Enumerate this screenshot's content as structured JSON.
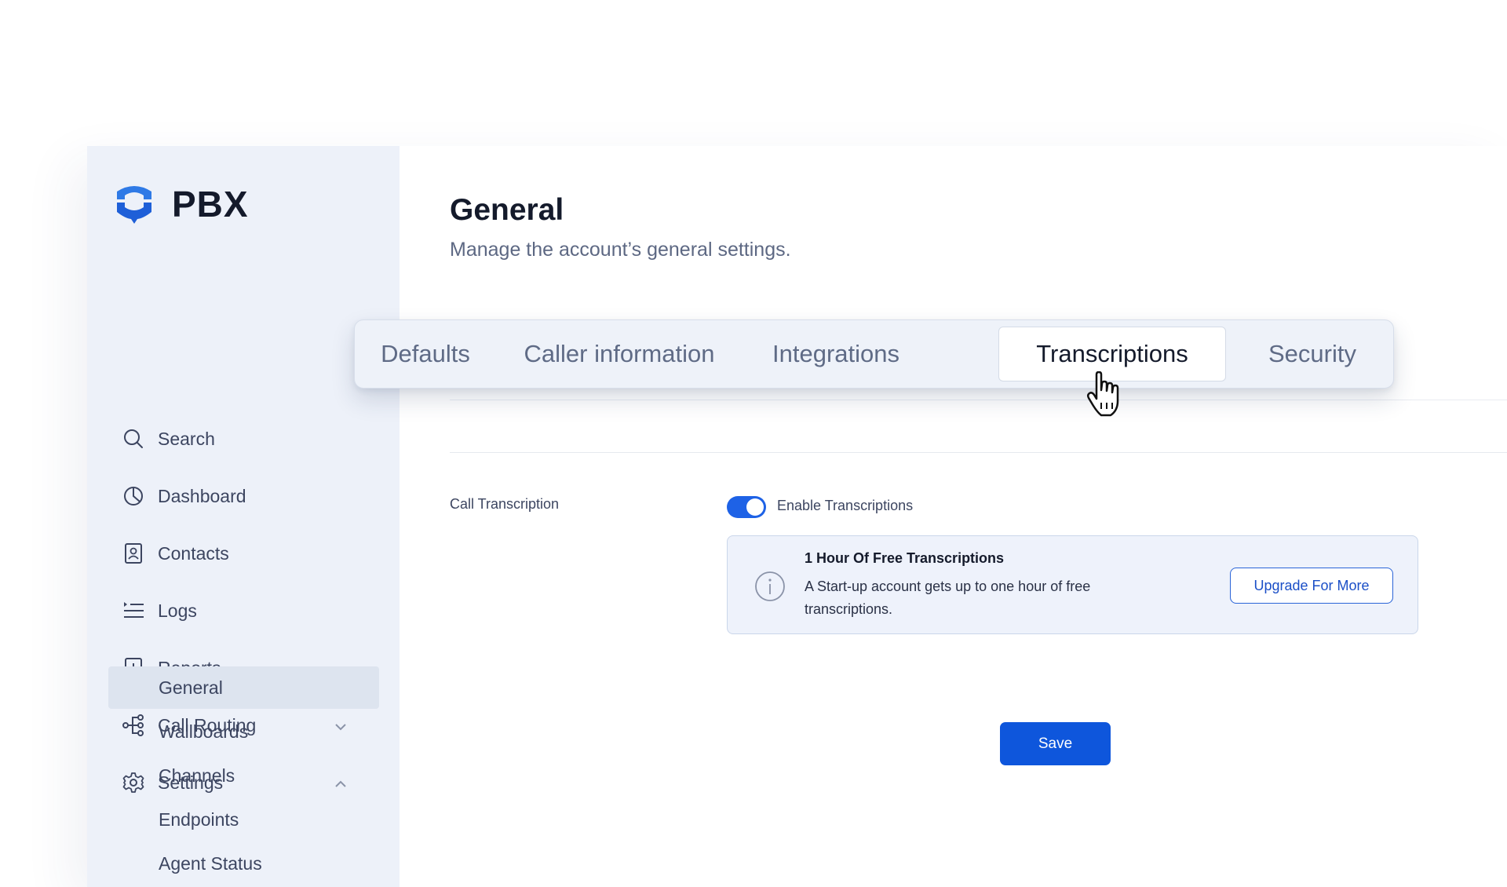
{
  "brand": {
    "name": "PBX",
    "accent": "#1e62e6"
  },
  "sidebar": {
    "items": [
      {
        "label": "Search",
        "icon": "search-icon"
      },
      {
        "label": "Dashboard",
        "icon": "pie-chart-icon"
      },
      {
        "label": "Contacts",
        "icon": "contact-book-icon"
      },
      {
        "label": "Logs",
        "icon": "list-icon"
      },
      {
        "label": "Reports",
        "icon": "bar-chart-icon",
        "expanded": false
      },
      {
        "label": "Call Routing",
        "icon": "routing-icon",
        "expanded": false
      },
      {
        "label": "Settings",
        "icon": "gear-icon",
        "expanded": true
      }
    ],
    "settings_sub": [
      {
        "label": "General",
        "active": true
      },
      {
        "label": "Wallboards"
      },
      {
        "label": "Channels"
      },
      {
        "label": "Endpoints"
      },
      {
        "label": "Agent Status"
      }
    ]
  },
  "page": {
    "title": "General",
    "subtitle": "Manage the account’s general settings."
  },
  "tabs": [
    {
      "label": "Defaults"
    },
    {
      "label": "Caller information"
    },
    {
      "label": "Integrations"
    },
    {
      "label": "Transcriptions",
      "active": true
    },
    {
      "label": "Security"
    }
  ],
  "transcription": {
    "field_label": "Call Transcription",
    "toggle_label": "Enable Transcriptions",
    "toggle_on": true,
    "card": {
      "title": "1 Hour Of Free Transcriptions",
      "body": "A Start-up account gets up to one hour of free transcriptions.",
      "button_label": "Upgrade For More"
    }
  },
  "actions": {
    "save_label": "Save"
  }
}
